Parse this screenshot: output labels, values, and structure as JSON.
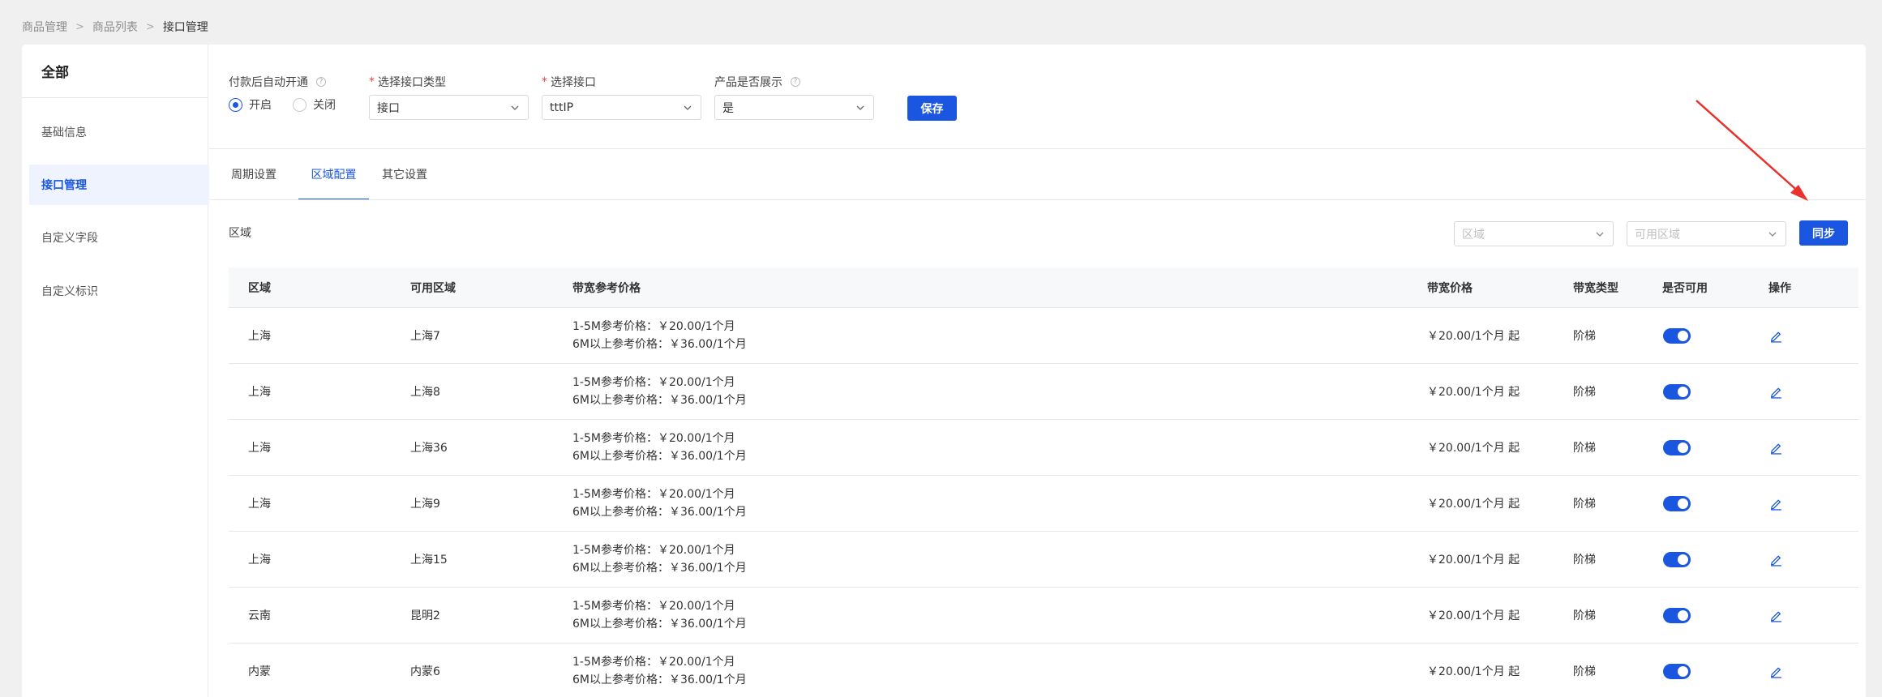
{
  "breadcrumb": [
    "商品管理",
    "商品列表",
    "接口管理"
  ],
  "sidebar": {
    "title": "全部",
    "items": [
      {
        "label": "基础信息",
        "active": false
      },
      {
        "label": "接口管理",
        "active": true
      },
      {
        "label": "自定义字段",
        "active": false
      },
      {
        "label": "自定义标识",
        "active": false
      }
    ]
  },
  "form": {
    "auto_open": {
      "label": "付款后自动开通",
      "options": [
        "开启",
        "关闭"
      ],
      "selected": "开启"
    },
    "interface_type": {
      "label": "选择接口类型",
      "value": "接口"
    },
    "interface": {
      "label": "选择接口",
      "value": "tttIP"
    },
    "show_product": {
      "label": "产品是否展示",
      "value": "是"
    },
    "save_label": "保存"
  },
  "tabs": [
    {
      "label": "周期设置",
      "active": false
    },
    {
      "label": "区域配置",
      "active": true
    },
    {
      "label": "其它设置",
      "active": false
    }
  ],
  "region_section": {
    "label": "区域",
    "filter_region_placeholder": "区域",
    "filter_available_placeholder": "可用区域",
    "sync_label": "同步"
  },
  "table": {
    "columns": [
      "区域",
      "可用区域",
      "带宽参考价格",
      "带宽价格",
      "带宽类型",
      "是否可用",
      "操作"
    ],
    "rows": [
      {
        "region": "上海",
        "zone": "上海7",
        "ref1": "1-5M参考价格：￥20.00/1个月",
        "ref2": "6M以上参考价格：￥36.00/1个月",
        "price": "￥20.00/1个月 起",
        "type": "阶梯",
        "enabled": true
      },
      {
        "region": "上海",
        "zone": "上海8",
        "ref1": "1-5M参考价格：￥20.00/1个月",
        "ref2": "6M以上参考价格：￥36.00/1个月",
        "price": "￥20.00/1个月 起",
        "type": "阶梯",
        "enabled": true
      },
      {
        "region": "上海",
        "zone": "上海36",
        "ref1": "1-5M参考价格：￥20.00/1个月",
        "ref2": "6M以上参考价格：￥36.00/1个月",
        "price": "￥20.00/1个月 起",
        "type": "阶梯",
        "enabled": true
      },
      {
        "region": "上海",
        "zone": "上海9",
        "ref1": "1-5M参考价格：￥20.00/1个月",
        "ref2": "6M以上参考价格：￥36.00/1个月",
        "price": "￥20.00/1个月 起",
        "type": "阶梯",
        "enabled": true
      },
      {
        "region": "上海",
        "zone": "上海15",
        "ref1": "1-5M参考价格：￥20.00/1个月",
        "ref2": "6M以上参考价格：￥36.00/1个月",
        "price": "￥20.00/1个月 起",
        "type": "阶梯",
        "enabled": true
      },
      {
        "region": "云南",
        "zone": "昆明2",
        "ref1": "1-5M参考价格：￥20.00/1个月",
        "ref2": "6M以上参考价格：￥36.00/1个月",
        "price": "￥20.00/1个月 起",
        "type": "阶梯",
        "enabled": true
      },
      {
        "region": "内蒙",
        "zone": "内蒙6",
        "ref1": "1-5M参考价格：￥20.00/1个月",
        "ref2": "6M以上参考价格：￥36.00/1个月",
        "price": "￥20.00/1个月 起",
        "type": "阶梯",
        "enabled": true
      }
    ]
  },
  "colors": {
    "primary": "#1a56e0",
    "annotation_arrow": "#e8322b"
  }
}
